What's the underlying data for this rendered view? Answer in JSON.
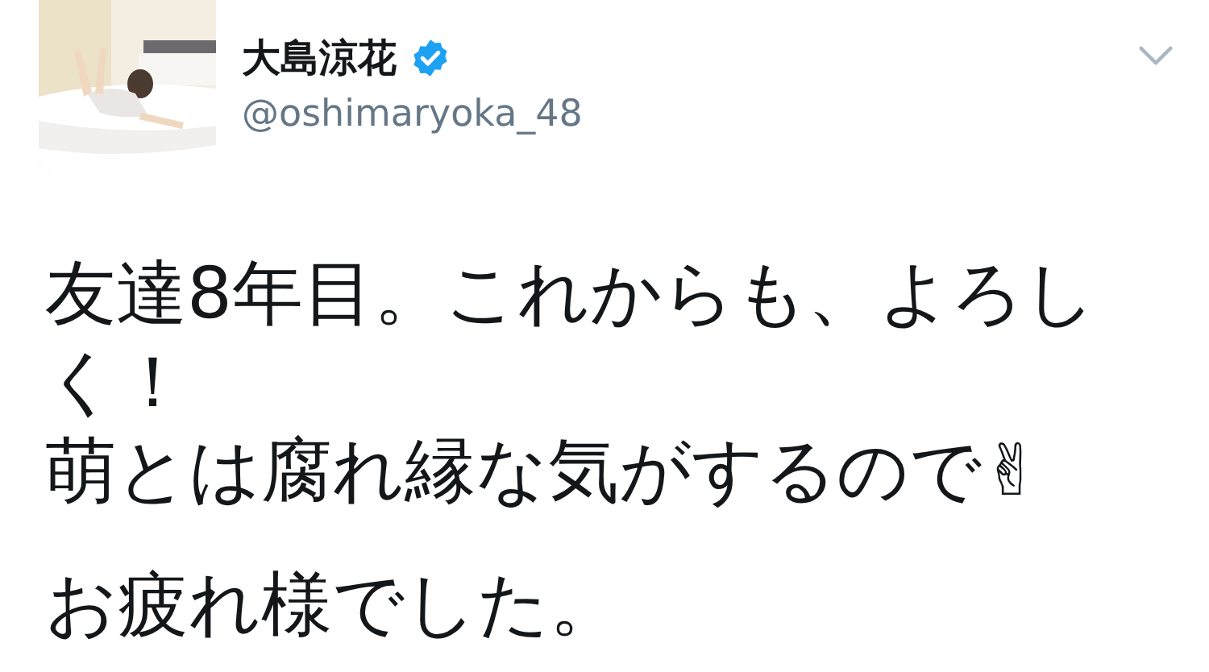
{
  "tweet": {
    "author": {
      "name": "大島涼花",
      "verified": true,
      "handle": "@oshimaryoka_48"
    },
    "paragraphs": [
      {
        "lines": [
          "友達8年目。これからも、よろしく！",
          "萌とは腐れ縁な気がするので✌"
        ]
      },
      {
        "lines": [
          "お疲れ様でした。"
        ]
      }
    ]
  }
}
